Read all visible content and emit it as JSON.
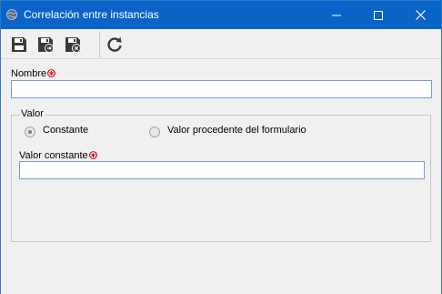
{
  "window": {
    "title": "Correlación entre instancias"
  },
  "toolbar": {
    "buttons": [
      {
        "icon": "save-icon"
      },
      {
        "icon": "save-and-new-icon"
      },
      {
        "icon": "save-and-close-icon"
      },
      {
        "icon": "refresh-icon"
      }
    ]
  },
  "form": {
    "name_label": "Nombre",
    "name_value": "",
    "valor_legend": "Valor",
    "radio_constant_label": "Constante",
    "radio_constant_checked": true,
    "radio_form_label": "Valor procedente del formulario",
    "radio_form_checked": false,
    "constant_value_label": "Valor constante",
    "constant_value": ""
  },
  "colors": {
    "titlebar": "#0a64c8",
    "required": "#d0021b",
    "input_border": "#7a9cc7"
  }
}
